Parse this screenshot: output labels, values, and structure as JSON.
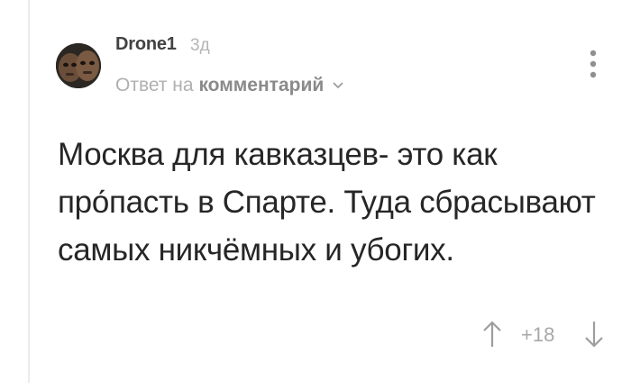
{
  "comment": {
    "author": "Drone1",
    "time": "3д",
    "reply_prefix": "Ответ на",
    "reply_link": "комментарий",
    "text": "Москва для кавказцев- это как про́пасть в Спарте. Туда сбрасывают самых никчёмных и убогих.",
    "rating": "+18"
  },
  "icons": {
    "avatar": "avatar-image",
    "reply_dropdown": "chevron-down-icon",
    "more": "more-vertical-icon",
    "upvote": "arrow-up-icon",
    "downvote": "arrow-down-icon"
  },
  "colors": {
    "author": "#424242",
    "muted": "#b0b0b0",
    "text": "#262626",
    "icon": "#9e9e9e"
  }
}
